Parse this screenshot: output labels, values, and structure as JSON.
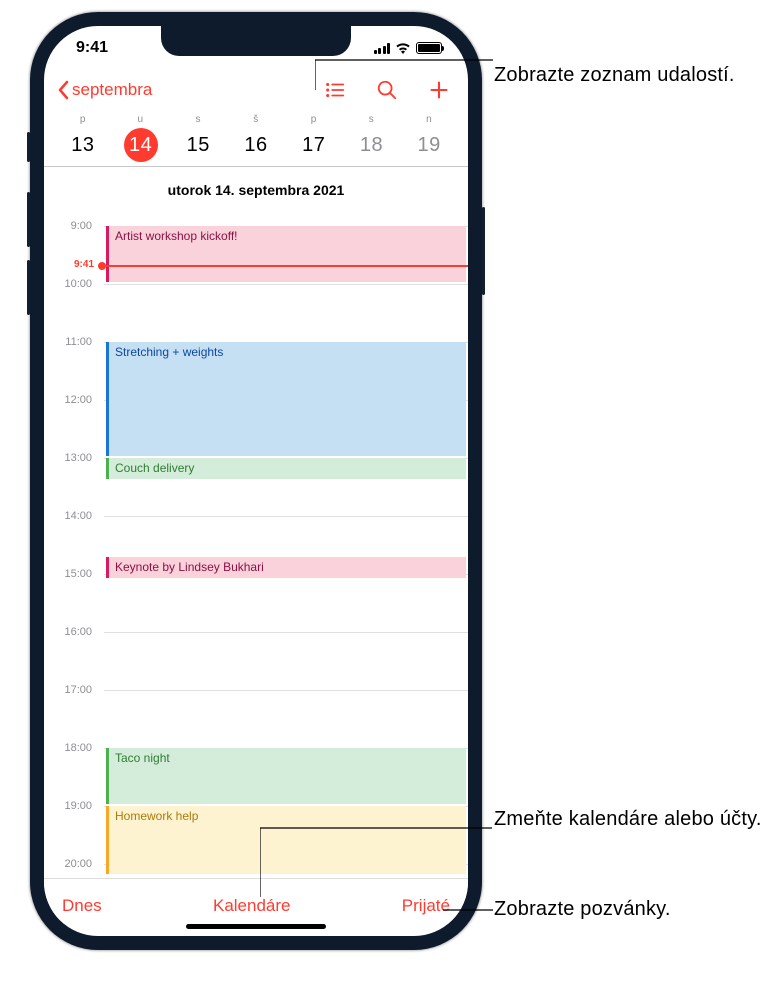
{
  "status": {
    "time": "9:41"
  },
  "nav": {
    "back_label": "septembra"
  },
  "week": {
    "abbrs": [
      "p",
      "u",
      "s",
      "š",
      "p",
      "s",
      "n"
    ],
    "nums": [
      "13",
      "14",
      "15",
      "16",
      "17",
      "18",
      "19"
    ],
    "selected_index": 1,
    "weekend_start": 5
  },
  "datefull": "utorok  14. septembra 2021",
  "now": {
    "label": "9:41",
    "offset_hour": 9.68
  },
  "hours": [
    "9:00",
    "10:00",
    "11:00",
    "12:00",
    "13:00",
    "14:00",
    "15:00",
    "16:00",
    "17:00",
    "18:00",
    "19:00",
    "20:00"
  ],
  "events": [
    {
      "title": "Artist workshop kickoff!",
      "start": 9.0,
      "end": 10.0,
      "color": "pink"
    },
    {
      "title": "Stretching + weights",
      "start": 11.0,
      "end": 13.0,
      "color": "blue"
    },
    {
      "title": "Couch delivery",
      "start": 13.0,
      "end": 13.4,
      "color": "green"
    },
    {
      "title": "Keynote by Lindsey Bukhari",
      "start": 14.7,
      "end": 15.1,
      "color": "pink2"
    },
    {
      "title": "Taco night",
      "start": 18.0,
      "end": 19.0,
      "color": "green"
    },
    {
      "title": "Homework help",
      "start": 19.0,
      "end": 20.2,
      "color": "yellow"
    }
  ],
  "toolbar": {
    "today": "Dnes",
    "calendars": "Kalendáre",
    "inbox": "Prijaté"
  },
  "callouts": {
    "c1": "Zobrazte zoznam udalostí.",
    "c2": "Zmeňte kalendáre alebo účty.",
    "c3": "Zobrazte pozvánky."
  }
}
